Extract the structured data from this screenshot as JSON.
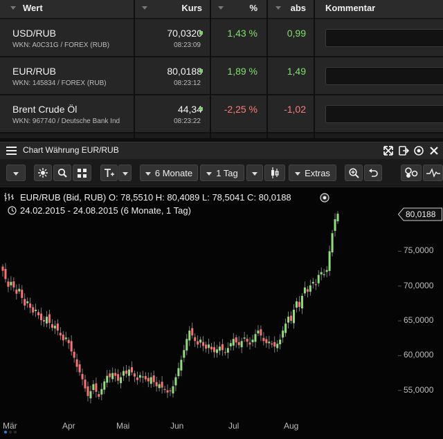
{
  "table": {
    "headers": {
      "wert": "Wert",
      "kurs": "Kurs",
      "pct": "%",
      "abs": "abs",
      "kommentar": "Kommentar"
    },
    "rows": [
      {
        "name": "USD/RUB",
        "wkn": "WKN: A0C31G / FOREX (RUB)",
        "kurs": "70,0320",
        "time": "08:23:09",
        "pct": "1,43 %",
        "abs": "0,99",
        "dir": "up"
      },
      {
        "name": "EUR/RUB",
        "wkn": "WKN: 145834 / FOREX (RUB)",
        "kurs": "80,0188",
        "time": "08:23:12",
        "pct": "1,89 %",
        "abs": "1,49",
        "dir": "up"
      },
      {
        "name": "Brent Crude Öl",
        "wkn": "WKN: 967740 / Deutsche Bank Ind",
        "kurs": "44,34",
        "time": "08:23:22",
        "pct": "-2,25 %",
        "abs": "-1,02",
        "dir": "down"
      }
    ]
  },
  "chart_window": {
    "title": "Chart Währung EUR/RUB",
    "toolbar": {
      "period": "6 Monate",
      "interval": "1 Tag",
      "extras": "Extras"
    },
    "info_line": "EUR/RUB (Bid, RUB)  O: 78,5510  H: 80,4089  L: 78,5041  C: 80,0188",
    "range_line": "24.02.2015 - 24.08.2015 (6 Monate, 1 Tag)",
    "last_value": "80,0188"
  },
  "chart_data": {
    "type": "candlestick",
    "up_color": "#8fe07a",
    "down_color": "#ff7070",
    "x_tick_labels": [
      "Mär",
      "Apr",
      "Mai",
      "Jun",
      "Jul",
      "Aug"
    ],
    "y_tick_labels": [
      "55,0000",
      "60,0000",
      "65,0000",
      "70,0000",
      "75,0000"
    ],
    "y_ticks": [
      55,
      60,
      65,
      70,
      75
    ],
    "ylim": [
      51.2,
      81.8
    ],
    "close": [
      72.2,
      71.0,
      69.9,
      70.6,
      69.8,
      68.9,
      69.6,
      68.3,
      67.2,
      67.8,
      66.9,
      66.2,
      66.6,
      65.8,
      65.1,
      64.9,
      65.6,
      64.7,
      64.0,
      64.3,
      63.6,
      62.9,
      62.2,
      62.6,
      61.8,
      60.6,
      59.7,
      58.4,
      57.6,
      56.6,
      55.3,
      54.2,
      54.9,
      55.9,
      54.8,
      54.1,
      55.2,
      56.3,
      57.1,
      56.9,
      57.5,
      57.1,
      56.4,
      56.9,
      57.8,
      57.4,
      58.0,
      57.6,
      57.0,
      56.5,
      57.2,
      57.0,
      56.6,
      56.3,
      56.9,
      56.2,
      55.6,
      55.9,
      55.4,
      55.1,
      54.7,
      54.9,
      55.6,
      56.9,
      58.2,
      59.4,
      60.8,
      62.4,
      63.6,
      62.9,
      62.1,
      61.6,
      62.3,
      61.4,
      61.0,
      61.6,
      60.9,
      60.5,
      60.9,
      61.3,
      60.8,
      60.4,
      61.1,
      61.8,
      62.4,
      61.9,
      61.5,
      62.1,
      62.6,
      62.0,
      61.6,
      62.3,
      63.1,
      63.6,
      62.9,
      62.1,
      61.8,
      62.0,
      61.6,
      61.3,
      61.7,
      62.3,
      63.6,
      64.6,
      65.6,
      65.0,
      66.6,
      67.8,
      67.0,
      68.6,
      69.8,
      69.2,
      70.1,
      70.6,
      70.2,
      71.6,
      72.0,
      71.7,
      72.3,
      75.0,
      77.6,
      79.6,
      80.4
    ]
  }
}
